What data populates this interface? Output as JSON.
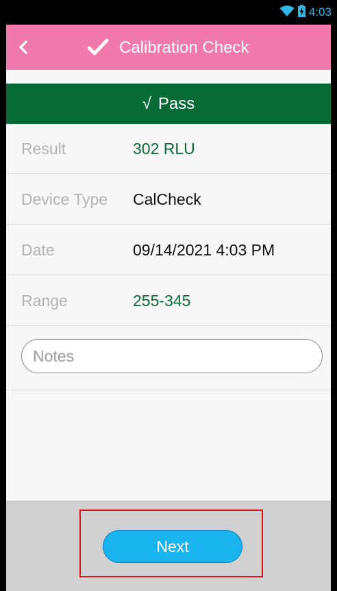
{
  "status_bar": {
    "time": "4:03",
    "icons": [
      "wifi-icon",
      "battery-charging-icon"
    ]
  },
  "header": {
    "title": "Calibration Check",
    "back_icon": "chevron-left-icon",
    "title_icon": "checkmark-icon"
  },
  "banner": {
    "check": "√",
    "text": "Pass",
    "color": "#056a35"
  },
  "rows": [
    {
      "label": "Result",
      "value": "302 RLU",
      "value_color": "#0b6b35"
    },
    {
      "label": "Device Type",
      "value": "CalCheck",
      "value_color": "#111111"
    },
    {
      "label": "Date",
      "value": "09/14/2021 4:03 PM",
      "value_color": "#111111"
    },
    {
      "label": "Range",
      "value": "255-345",
      "value_color": "#0b6b35"
    }
  ],
  "notes": {
    "placeholder": "Notes",
    "value": ""
  },
  "footer": {
    "next_label": "Next",
    "next_color": "#19b3ee",
    "highlight_color": "#e0141b"
  },
  "colors": {
    "header_bg": "#f27aaa",
    "status_accent": "#33b5e5"
  }
}
